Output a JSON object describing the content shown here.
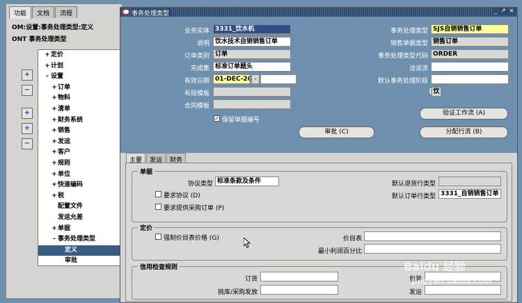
{
  "navigator": {
    "tabs": [
      "功能",
      "文档",
      "流程"
    ],
    "path1": "OM:设置:事务处理类型:定义",
    "path2": "ONT 事务处理类型",
    "tree": [
      {
        "mark": "+",
        "label": "定价",
        "indent": 1
      },
      {
        "mark": "+",
        "label": "计划",
        "indent": 1
      },
      {
        "mark": "-",
        "label": "设置",
        "indent": 1
      },
      {
        "mark": "+",
        "label": "订单",
        "indent": 2
      },
      {
        "mark": "+",
        "label": "物料",
        "indent": 2
      },
      {
        "mark": "+",
        "label": "清单",
        "indent": 2
      },
      {
        "mark": "+",
        "label": "财务系统",
        "indent": 2
      },
      {
        "mark": "+",
        "label": "销售",
        "indent": 2
      },
      {
        "mark": "+",
        "label": "发运",
        "indent": 2
      },
      {
        "mark": "+",
        "label": "客户",
        "indent": 2
      },
      {
        "mark": "+",
        "label": "规则",
        "indent": 2
      },
      {
        "mark": "+",
        "label": "单位",
        "indent": 2
      },
      {
        "mark": "+",
        "label": "快速编码",
        "indent": 2
      },
      {
        "mark": "+",
        "label": "税",
        "indent": 2
      },
      {
        "mark": "",
        "label": "配置文件",
        "indent": 2
      },
      {
        "mark": "",
        "label": "发运允差",
        "indent": 2
      },
      {
        "mark": "+",
        "label": "单据",
        "indent": 2
      },
      {
        "mark": "-",
        "label": "事务处理类型",
        "indent": 2
      },
      {
        "mark": "",
        "label": "定义",
        "indent": 3,
        "selected": true
      },
      {
        "mark": "",
        "label": "审批",
        "indent": 3
      }
    ],
    "side_buttons": [
      "+",
      "−",
      "+",
      "+",
      "−"
    ]
  },
  "window": {
    "title": "事务处理类型",
    "controls": [
      "_",
      "↗",
      "×"
    ],
    "left_fields": [
      {
        "label": "业务实体",
        "value": "3331_饮水机",
        "style": "sel"
      },
      {
        "label": "说明",
        "value": "饮水技术自销销售订单",
        "style": "white"
      },
      {
        "label": "订单类别",
        "value": "订单",
        "style": "ro"
      },
      {
        "label": "完成集",
        "value": "标准订单题头",
        "style": "white"
      },
      {
        "label": "有效日期",
        "value": "01-DEC-200",
        "style": "yel"
      },
      {
        "label": "布局模板",
        "value": "",
        "style": "ro"
      },
      {
        "label": "合同模板",
        "value": "",
        "style": "ro"
      }
    ],
    "date_sep": "-",
    "right_fields": [
      {
        "label": "事务处理类型",
        "value": "SJS自销销售订单",
        "style": "yel"
      },
      {
        "label": "销售单据类型",
        "value": "销售订单",
        "style": "ro"
      },
      {
        "label": "事务处理类型代码",
        "value": "ORDER",
        "style": "ro"
      },
      {
        "label": "洽谈流",
        "value": "",
        "style": "white"
      },
      {
        "label": "默认事务处理阶段",
        "value": "",
        "style": "white"
      }
    ],
    "bracket_value": "饮",
    "retain_label": "保留单据编号",
    "retain_checked": "✓",
    "buttons": {
      "validate": "验证工作流 (A)",
      "approve": "审批 (C)",
      "assign": "分配行流 (B)"
    }
  },
  "lower": {
    "tabs": [
      "主要",
      "发运",
      "财务"
    ],
    "doc_group": {
      "title": "单据",
      "agreement_type_label": "协议类型",
      "agreement_type_value": "标准条款及条件",
      "require_agreement": "要求协议 (D)",
      "require_po": "要求提供采购订单 (P)",
      "default_return_label": "默认退货行类型",
      "default_return_value": "",
      "default_order_label": "默认订单行类型",
      "default_order_value": "3331_自销销售订单"
    },
    "price_group": {
      "title": "定价",
      "enforce_list": "强制价目表价格 (G)",
      "price_list_label": "价目表",
      "min_margin_label": "最小利润百分比"
    },
    "credit_group": {
      "title": "信用检查规则",
      "order_label": "订货",
      "pick_label": "挑库/采购发放",
      "pack_label": "包装",
      "ship_label": "发运"
    }
  },
  "watermark": {
    "text": "Baidu 经验",
    "url": "jingyan.baidu.com"
  }
}
